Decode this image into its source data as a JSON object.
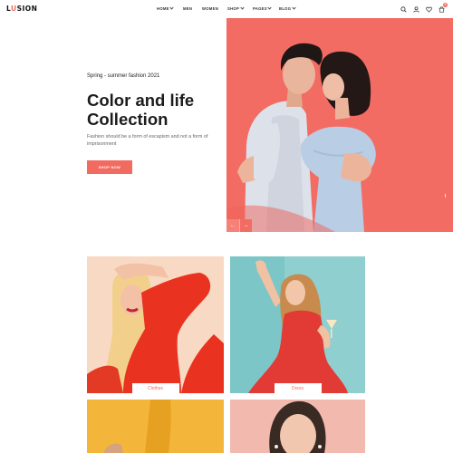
{
  "brand": {
    "logo_pre": "L",
    "logo_o": "U",
    "logo_post": "SION",
    "accent": "#f26b61"
  },
  "nav": {
    "items": [
      {
        "label": "HOME",
        "dropdown": true
      },
      {
        "label": "MEN",
        "dropdown": false
      },
      {
        "label": "WOMEN",
        "dropdown": false
      },
      {
        "label": "SHOP",
        "dropdown": true
      },
      {
        "label": "PAGES",
        "dropdown": true
      },
      {
        "label": "BLOG",
        "dropdown": true
      }
    ]
  },
  "header_icons": [
    "search-icon",
    "user-icon",
    "heart-icon",
    "cart-icon"
  ],
  "cart_count": "0",
  "hero": {
    "subtitle": "Spring - summer fashion 2021",
    "title_line1": "Color and life",
    "title_line2": "Collection",
    "description": "Fashion should be a form of escapism and not a form of imprisonment",
    "cta": "SHOP NOW",
    "bg_color": "#f36c63",
    "prev_label": "←",
    "next_label": "→"
  },
  "categories": [
    {
      "label": "Clothes",
      "bg": "#f8d9c3"
    },
    {
      "label": "Dress",
      "bg": "#8fcfd0"
    },
    {
      "label": "",
      "bg": "#f4b63a"
    },
    {
      "label": "",
      "bg": "#f2b9ae"
    }
  ]
}
